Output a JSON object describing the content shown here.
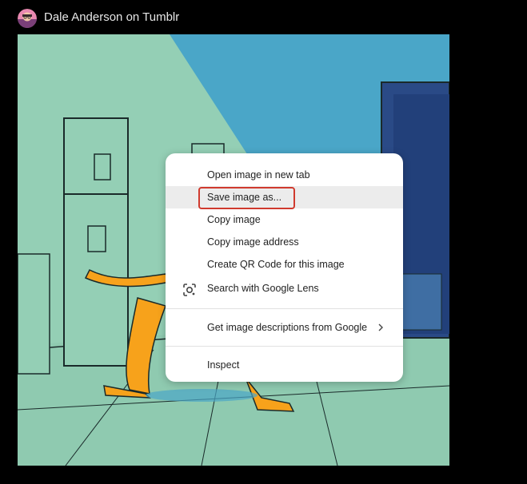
{
  "header": {
    "title": "Dale Anderson on Tumblr"
  },
  "colors": {
    "background": "#000000",
    "scene_green": "#94cfb5",
    "scene_blue": "#4aa6c8",
    "door_blue": "#2a4a86",
    "figure_orange": "#f7a21b",
    "menu_highlight_border": "#d03a2e"
  },
  "context_menu": {
    "items": [
      {
        "label": "Open image in new tab"
      },
      {
        "label": "Save image as...",
        "state": "hovered"
      },
      {
        "label": "Copy image"
      },
      {
        "label": "Copy image address"
      },
      {
        "label": "Create QR Code for this image"
      },
      {
        "label": "Search with Google Lens",
        "icon": "google-lens-icon"
      }
    ],
    "descriptions_item": {
      "label": "Get image descriptions from Google",
      "icon": "chevron-right-icon"
    },
    "inspect_item": {
      "label": "Inspect"
    }
  }
}
